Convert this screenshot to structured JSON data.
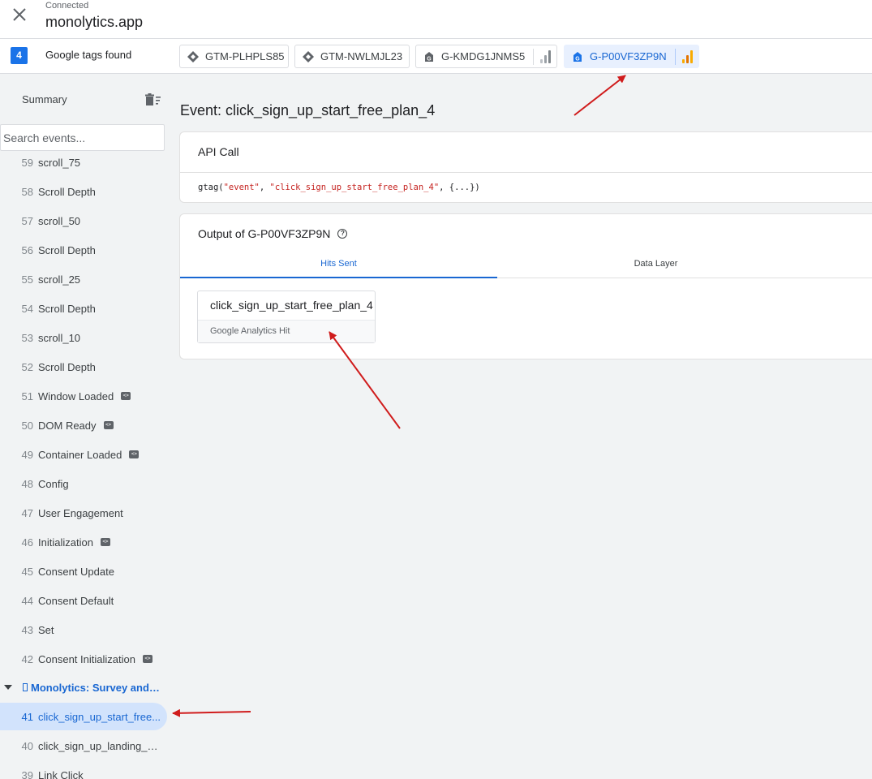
{
  "header": {
    "status": "Connected",
    "domain": "monolytics.app"
  },
  "tagbar": {
    "count": "4",
    "label": "Google tags found",
    "tags": [
      {
        "id": "GTM-PLHPLS85",
        "icon": "gtm-diamond-icon"
      },
      {
        "id": "GTM-NWLMJL23",
        "icon": "gtm-diamond-icon"
      },
      {
        "id": "G-KMDG1JNMS5",
        "icon": "google-tag-icon",
        "analytics_icon": "analytics-bars-icon-grey"
      },
      {
        "id": "G-P00VF3ZP9N",
        "icon": "google-tag-icon",
        "analytics_icon": "analytics-bars-icon-orange",
        "active": true
      }
    ]
  },
  "sidebar": {
    "summary_label": "Summary",
    "search_placeholder": "Search events...",
    "events": [
      {
        "num": "59",
        "label": "scroll_75"
      },
      {
        "num": "58",
        "label": "Scroll Depth"
      },
      {
        "num": "57",
        "label": "scroll_50"
      },
      {
        "num": "56",
        "label": "Scroll Depth"
      },
      {
        "num": "55",
        "label": "scroll_25"
      },
      {
        "num": "54",
        "label": "Scroll Depth"
      },
      {
        "num": "53",
        "label": "scroll_10"
      },
      {
        "num": "52",
        "label": "Scroll Depth"
      },
      {
        "num": "51",
        "label": "Window Loaded",
        "code_icon": true
      },
      {
        "num": "50",
        "label": "DOM Ready",
        "code_icon": true
      },
      {
        "num": "49",
        "label": "Container Loaded",
        "code_icon": true
      },
      {
        "num": "48",
        "label": "Config"
      },
      {
        "num": "47",
        "label": "User Engagement"
      },
      {
        "num": "46",
        "label": "Initialization",
        "code_icon": true
      },
      {
        "num": "45",
        "label": "Consent Update"
      },
      {
        "num": "44",
        "label": "Consent Default"
      },
      {
        "num": "43",
        "label": "Set"
      },
      {
        "num": "42",
        "label": "Consent Initialization",
        "code_icon": true
      }
    ],
    "group_label": "Monolytics: Survey and R...",
    "group_events": [
      {
        "num": "41",
        "label": "click_sign_up_start_free...",
        "selected": true
      },
      {
        "num": "40",
        "label": "click_sign_up_landing_p..."
      },
      {
        "num": "39",
        "label": "Link Click"
      }
    ]
  },
  "main": {
    "event_title": "Event: click_sign_up_start_free_plan_4",
    "api_call": {
      "header": "API Call",
      "code_prefix": "gtag(",
      "code_arg1": "\"event\"",
      "code_sep": ", ",
      "code_arg2": "\"click_sign_up_start_free_plan_4\"",
      "code_suffix": ", {...})"
    },
    "output": {
      "header": "Output of G-P00VF3ZP9N",
      "tabs": [
        "Hits Sent",
        "Data Layer"
      ],
      "hit": {
        "name": "click_sign_up_start_free_plan_4",
        "type": "Google Analytics Hit"
      }
    }
  },
  "colors": {
    "accent": "#1a73e8",
    "selected_bg": "#d2e3fc",
    "annotation_arrow": "#d01c1c",
    "analytics_orange": "#f9ab00"
  }
}
